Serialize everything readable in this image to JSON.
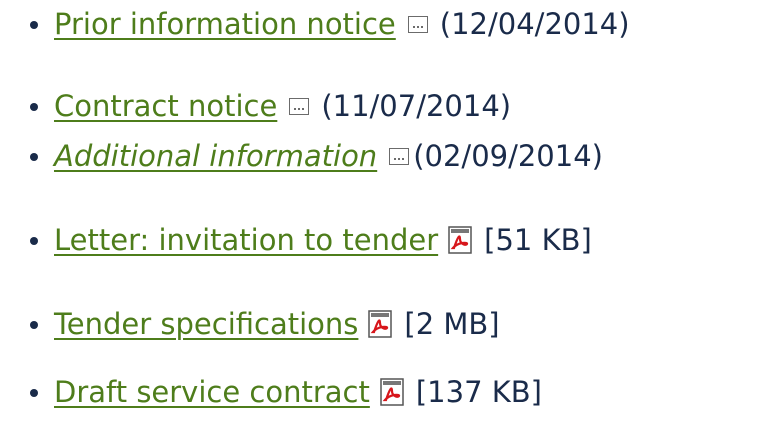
{
  "documents": [
    {
      "label": "Prior information notice",
      "italic": false,
      "icon": "external-window-icon",
      "meta": "(12/04/2014)"
    },
    {
      "label": "Contract notice",
      "italic": false,
      "icon": "external-window-icon",
      "meta": "(11/07/2014)"
    },
    {
      "label": "Additional information",
      "italic": true,
      "icon": "external-window-icon",
      "meta": "(02/09/2014)"
    },
    {
      "label": "Letter: invitation to tender",
      "italic": false,
      "icon": "pdf-icon",
      "meta": "[51 KB]"
    },
    {
      "label": "Tender specifications",
      "italic": false,
      "icon": "pdf-icon",
      "meta": "[2 MB]"
    },
    {
      "label": "Draft service contract",
      "italic": false,
      "icon": "pdf-icon",
      "meta": "[137 KB]"
    }
  ],
  "colors": {
    "link": "#4e7d1b",
    "text": "#1a2b4a",
    "pdf_red": "#d7161b"
  }
}
